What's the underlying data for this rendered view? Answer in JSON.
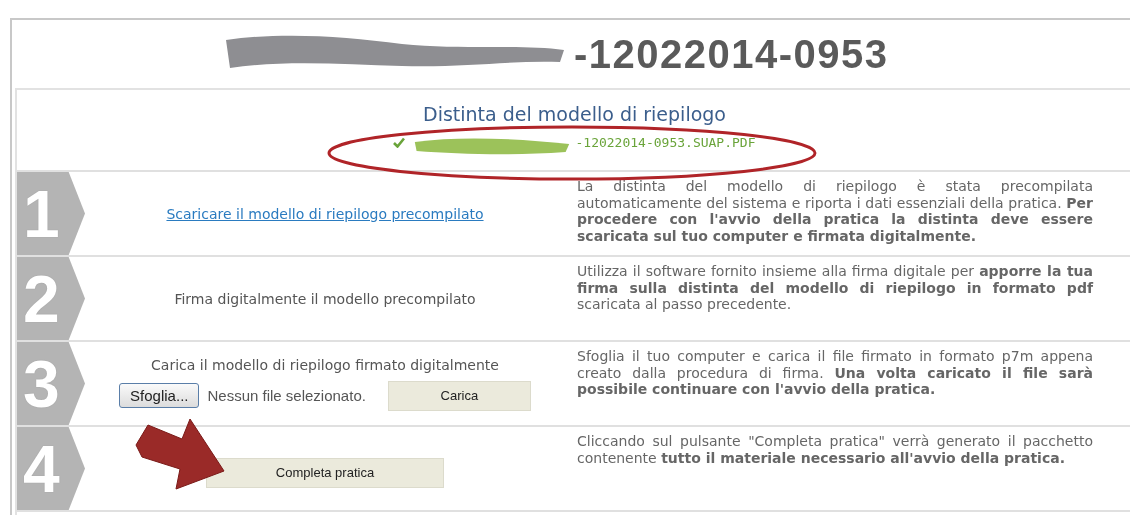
{
  "title": "-12022014-0953",
  "summary": {
    "heading": "Distinta del modello di riepilogo",
    "file_name": "-12022014-0953.SUAP.PDF"
  },
  "steps": [
    {
      "number": "1",
      "kind": "link",
      "label": "Scaricare il modello di riepilogo precompilato",
      "description": "La distinta del modello di riepilogo è stata precompilata automaticamente del sistema e riporta i dati essenziali della pratica. **Per procedere con l'avvio della pratica la distinta deve essere scaricata sul tuo computer e firmata digitalmente.**"
    },
    {
      "number": "2",
      "kind": "text",
      "label": "Firma digitalmente il modello precompilato",
      "description": "Utilizza il software fornito insieme alla firma digitale per **apporre la tua firma sulla distinta del modello di riepilogo in formato pdf** scaricata al passo precedente."
    },
    {
      "number": "3",
      "kind": "upload",
      "label": "Carica il modello di riepilogo firmato digitalmente",
      "browse_button": "Sfoglia...",
      "file_status": "Nessun file selezionato.",
      "upload_button": "Carica",
      "description": "Sfoglia il tuo computer e carica il file firmato in formato p7m appena creato dalla procedura di firma. **Una volta caricato il file sarà possibile continuare con l'avvio della pratica.**"
    },
    {
      "number": "4",
      "kind": "button",
      "button": "Completa pratica",
      "description": "Cliccando sul pulsante \"Completa pratica\" verrà generato il pacchetto contenente **tutto il materiale necessario all'avvio della pratica.**"
    }
  ]
}
